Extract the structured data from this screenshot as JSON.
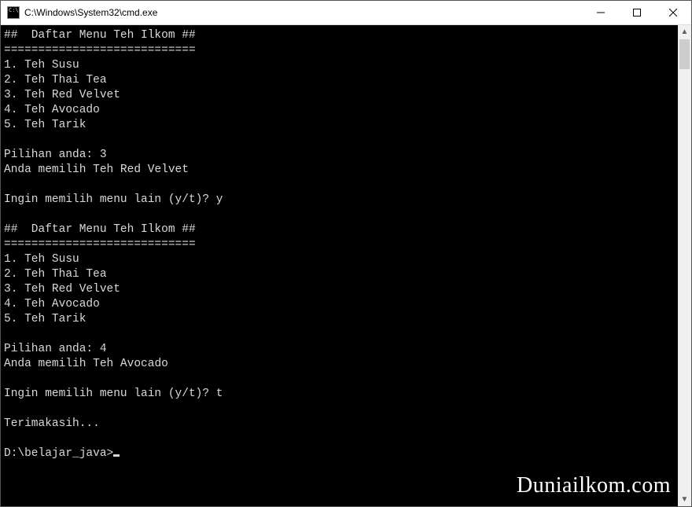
{
  "window": {
    "title": "C:\\Windows\\System32\\cmd.exe"
  },
  "terminal": {
    "header": "##  Daftar Menu Teh Ilkom ##",
    "divider": "============================",
    "menu": [
      "1. Teh Susu",
      "2. Teh Thai Tea",
      "3. Teh Red Velvet",
      "4. Teh Avocado",
      "5. Teh Tarik"
    ],
    "prompt_label": "Pilihan anda: ",
    "confirm_prefix": "Anda memilih ",
    "again_prompt": "Ingin memilih menu lain (y/t)? ",
    "session1": {
      "choice": "3",
      "selected": "Teh Red Velvet",
      "again": "y"
    },
    "session2": {
      "choice": "4",
      "selected": "Teh Avocado",
      "again": "t"
    },
    "thanks": "Terimakasih...",
    "cwd_prompt": "D:\\belajar_java>"
  },
  "watermark": "Duniailkom.com"
}
